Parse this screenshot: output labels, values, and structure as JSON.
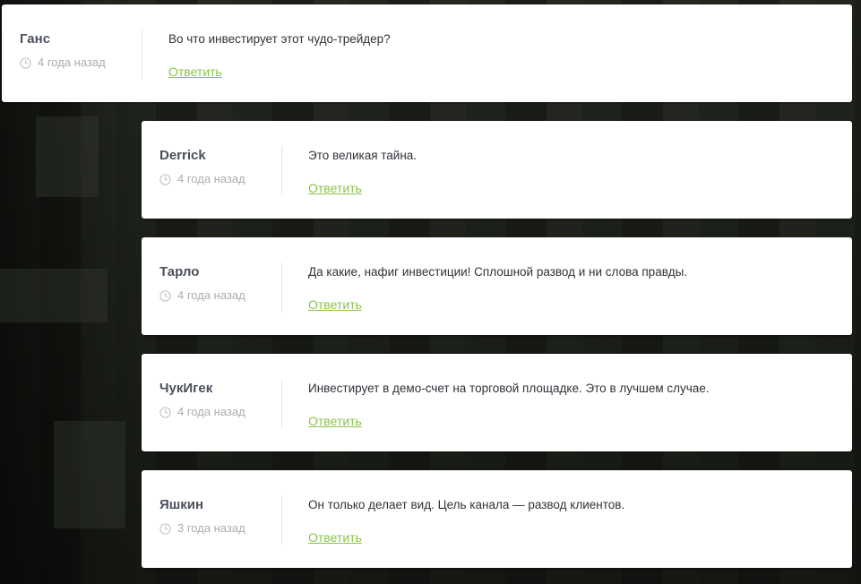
{
  "comments": [
    {
      "author": "Ганс",
      "date": "4 года назад",
      "text": "Во что инвестирует этот чудо-трейдер?",
      "reply_label": "Ответить"
    },
    {
      "author": "Derrick",
      "date": "4 года назад",
      "text": "Это великая тайна.",
      "reply_label": "Ответить"
    },
    {
      "author": "Тарло",
      "date": "4 года назад",
      "text": "Да какие, нафиг инвестиции! Сплошной развод и ни слова правды.",
      "reply_label": "Ответить"
    },
    {
      "author": "ЧукИгек",
      "date": "4 года назад",
      "text": "Инвестирует в демо-счет на торговой площадке. Это в лучшем случае.",
      "reply_label": "Ответить"
    },
    {
      "author": "Яшкин",
      "date": "3 года назад",
      "text": "Он только делает вид. Цель канала — развод клиентов.",
      "reply_label": "Ответить"
    }
  ],
  "colors": {
    "reply_link": "#8bc34a",
    "author": "#4b515a",
    "date": "#a9adb2"
  },
  "icons": {
    "date": "clock-icon"
  }
}
